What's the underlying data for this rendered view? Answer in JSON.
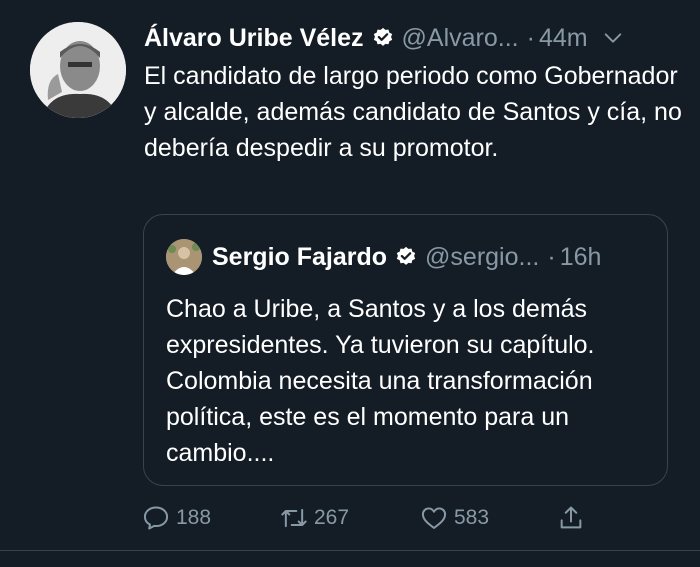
{
  "tweet": {
    "author_name": "Álvaro Uribe Vélez",
    "author_handle": "@Alvaro...",
    "separator": "·",
    "time": "44m",
    "text": "El candidato de largo periodo como Gobernador y alcalde, además candidato de Santos y cía, no debería despedir a su promotor."
  },
  "quoted": {
    "author_name": "Sergio Fajardo",
    "author_handle": "@sergio...",
    "separator": "·",
    "time": "16h",
    "text": "Chao a Uribe, a Santos y a los demás expresidentes. Ya tuvieron su capítulo. Colombia necesita una transformación política, este es el momento para un cambio...."
  },
  "actions": {
    "reply_count": "188",
    "retweet_count": "267",
    "like_count": "583"
  },
  "icons": {
    "verified": "verified-badge-icon",
    "more": "chevron-down-icon",
    "reply": "reply-icon",
    "retweet": "retweet-icon",
    "like": "heart-icon",
    "share": "share-icon"
  },
  "colors": {
    "background": "#141d26",
    "secondary_text": "#8899a6",
    "border": "#38444d"
  }
}
